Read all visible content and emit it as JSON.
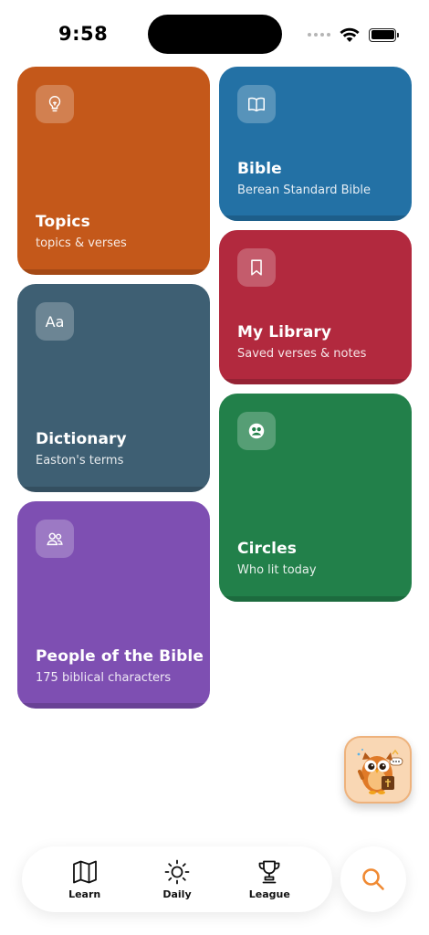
{
  "status_bar": {
    "time": "9:58"
  },
  "cards": {
    "topics": {
      "title": "Topics",
      "subtitle": "topics & verses",
      "icon": "lightbulb-icon",
      "color": "#c4581a"
    },
    "bible": {
      "title": "Bible",
      "subtitle": "Berean Standard Bible",
      "icon": "open-book-icon",
      "color": "#2371a5"
    },
    "library": {
      "title": "My Library",
      "subtitle": "Saved verses & notes",
      "icon": "bookmark-icon",
      "color": "#b2293e"
    },
    "dictionary": {
      "title": "Dictionary",
      "subtitle": "Easton's terms",
      "icon_text": "Aa",
      "color": "#3e5f73"
    },
    "circles": {
      "title": "Circles",
      "subtitle": "Who lit today",
      "icon": "circle-face-icon",
      "color": "#22804a"
    },
    "people": {
      "title": "People of the Bible",
      "subtitle": "175 biblical characters",
      "icon": "people-icon",
      "color": "#7e4fb2"
    }
  },
  "mascot": {
    "icon": "owl-mascot-icon"
  },
  "nav": {
    "items": [
      {
        "label": "Learn",
        "icon": "map-icon"
      },
      {
        "label": "Daily",
        "icon": "sun-icon"
      },
      {
        "label": "League",
        "icon": "trophy-icon"
      }
    ],
    "search": {
      "icon": "search-icon",
      "color": "#f08a33"
    }
  }
}
